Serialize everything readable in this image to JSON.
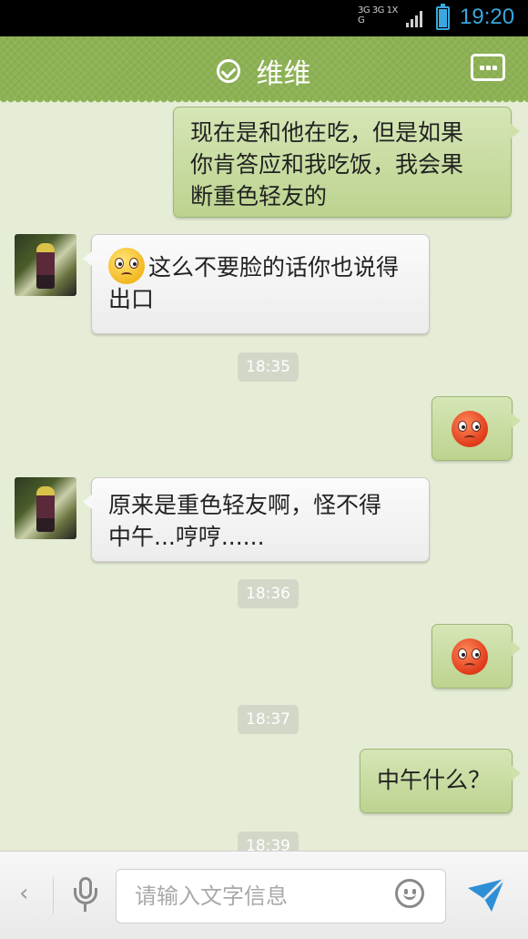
{
  "status_bar": {
    "network_top": "3G 3G 1X G",
    "clock": "19:20",
    "battery_level": 0.9
  },
  "header": {
    "title": "维维"
  },
  "messages": [
    {
      "side": "out",
      "text_lines": [
        "现在是和他在吃，但是如果",
        "你肯答应和我吃饭，我会果",
        "断重色轻友的"
      ]
    },
    {
      "side": "in",
      "text_lines": [
        "这么不要脸的话你也说得",
        "出口"
      ],
      "emoji": "angry-yellow-face-icon"
    },
    {
      "timestamp": "18:35"
    },
    {
      "side": "out",
      "emoji": "sweat-face-icon"
    },
    {
      "side": "in",
      "text_lines": [
        "原来是重色轻友啊，怪不得",
        "中午...哼哼......"
      ]
    },
    {
      "timestamp": "18:36"
    },
    {
      "side": "out",
      "emoji": "angry-face-icon"
    },
    {
      "timestamp": "18:37"
    },
    {
      "side": "out",
      "text_lines": [
        "中午什么？"
      ]
    },
    {
      "timestamp": "18:39"
    }
  ],
  "input_bar": {
    "placeholder": "请输入文字信息"
  },
  "colors": {
    "header_green": "#8db254",
    "chat_bg": "#e6edd6",
    "out_bubble": "#c6db9d",
    "in_bubble": "#f4f4f4",
    "clock_blue": "#3aa7de",
    "send_blue": "#2f8fd6"
  }
}
